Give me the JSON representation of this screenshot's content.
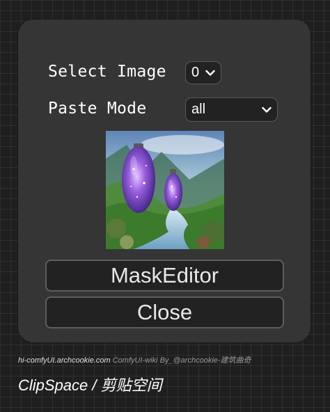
{
  "dialog": {
    "select_image": {
      "label": "Select Image",
      "value": "0"
    },
    "paste_mode": {
      "label": "Paste Mode",
      "value": "all"
    },
    "buttons": {
      "mask_editor": "MaskEditor",
      "close": "Close"
    }
  },
  "footer": {
    "site": "hi-comfyUI.archcookie.com",
    "wiki": "ComfyUI-wiki",
    "by": "By_@archcookie-建筑曲奇",
    "title": "ClipSpace / 剪贴空间"
  }
}
